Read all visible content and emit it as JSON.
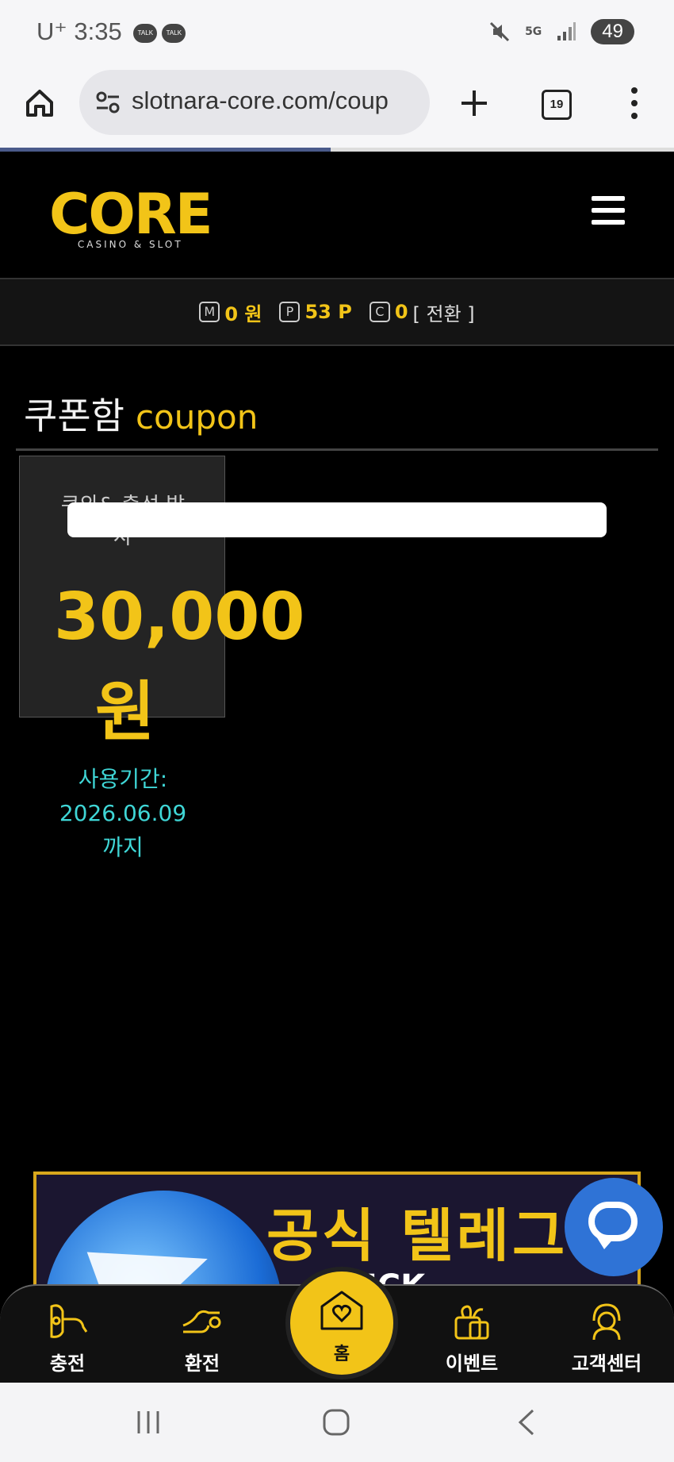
{
  "status_bar": {
    "carrier": "U⁺",
    "time": "3:35",
    "talk1": "TALK",
    "talk2": "TALK",
    "network": "5G",
    "battery": "49"
  },
  "browser": {
    "url": "slotnara-core.com/coup",
    "tab_count": "19",
    "progress": 0.49
  },
  "header": {
    "logo_text": "CORE",
    "logo_sub": "CASINO & SLOT"
  },
  "balance": {
    "money_icon": "M",
    "money_value": "0 원",
    "point_icon": "P",
    "point_value": "53 P",
    "coin_icon": "C",
    "coin_value": "0",
    "switch_label": "[ 전환 ]"
  },
  "coupon_page": {
    "title_ko": "쿠폰함",
    "title_en": "coupon",
    "coupon": {
      "name": "쿠와& 출석 발사",
      "amount": "30,000",
      "unit": "원"
    },
    "validity_label": "사용기간:",
    "validity_date": "2026.06.09",
    "validity_suffix": "까지"
  },
  "banner": {
    "text": "공식 텔레그램",
    "sub": "CLICK"
  },
  "bottom_nav": {
    "charge": "충전",
    "exchange": "환전",
    "home": "홈",
    "event": "이벤트",
    "support": "고객센터"
  },
  "colors": {
    "accent": "#f2c418",
    "validity": "#3fd6d6",
    "chat": "#2f73d6"
  }
}
